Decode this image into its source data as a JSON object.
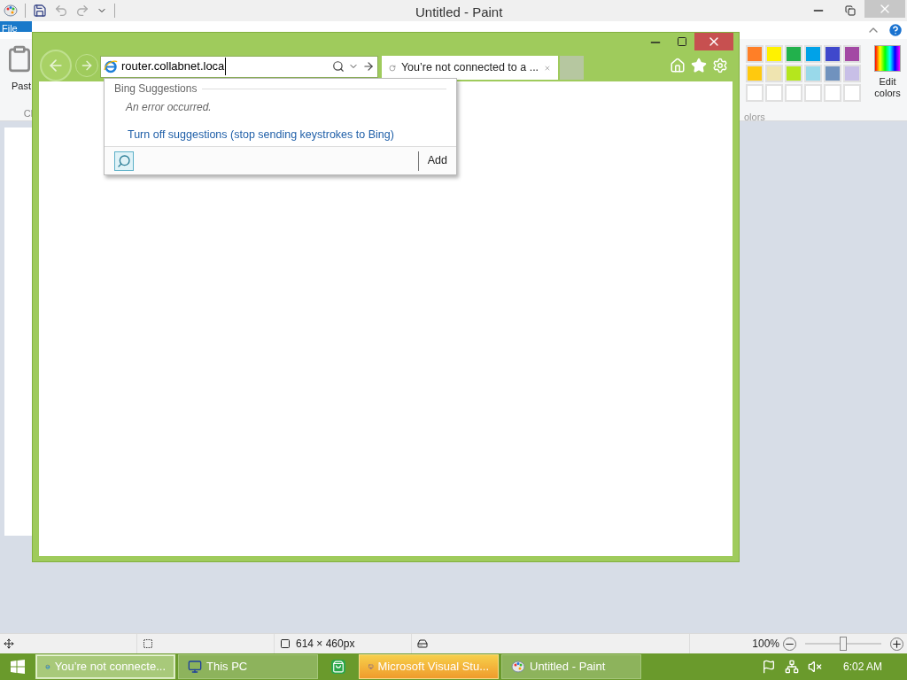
{
  "paint": {
    "title": "Untitled - Paint",
    "file_tab": "File",
    "paste_label": "Past",
    "clipboard_group_label": "Cl",
    "palette": [
      [
        {
          "color": "#ff7f27"
        },
        {
          "color": "#fff200"
        },
        {
          "color": "#22b14c"
        },
        {
          "color": "#00a2e8"
        },
        {
          "color": "#3f48cc"
        },
        {
          "color": "#a349a4"
        }
      ],
      [
        {
          "color": "#ffc90e"
        },
        {
          "color": "#efe4b0"
        },
        {
          "color": "#b5e61d"
        },
        {
          "color": "#99d9ea"
        },
        {
          "color": "#7092be"
        },
        {
          "color": "#c8bfe7"
        }
      ],
      [
        {
          "color": "#ffffff"
        },
        {
          "color": "#ffffff"
        },
        {
          "color": "#ffffff"
        },
        {
          "color": "#ffffff"
        },
        {
          "color": "#ffffff"
        },
        {
          "color": "#ffffff"
        }
      ]
    ],
    "edit_colors": "Edit colors",
    "colors_group_label": "olors",
    "status": {
      "dimensions": "614 × 460px",
      "zoom": "100%",
      "zoom_slider": {
        "level": 0.5
      }
    }
  },
  "browser": {
    "address": "router.collabnet.loca",
    "tab_title": "You’re not connected to a ...",
    "suggestions": {
      "heading": "Bing Suggestions",
      "error": "An error occurred.",
      "link": "Turn off suggestions (stop sending keystrokes to Bing)",
      "add": "Add"
    }
  },
  "taskbar": {
    "items": [
      {
        "kind": "ie",
        "label": "You’re not connecte...",
        "active": true,
        "flashing": false
      },
      {
        "kind": "explorer",
        "label": "This PC",
        "active": false,
        "flashing": false
      },
      {
        "kind": "store"
      },
      {
        "kind": "vs",
        "label": "Microsoft Visual Stu...",
        "active": false,
        "flashing": true
      },
      {
        "kind": "paint",
        "label": "Untitled - Paint",
        "active": false,
        "flashing": false
      }
    ],
    "clock": "6:02 AM"
  }
}
